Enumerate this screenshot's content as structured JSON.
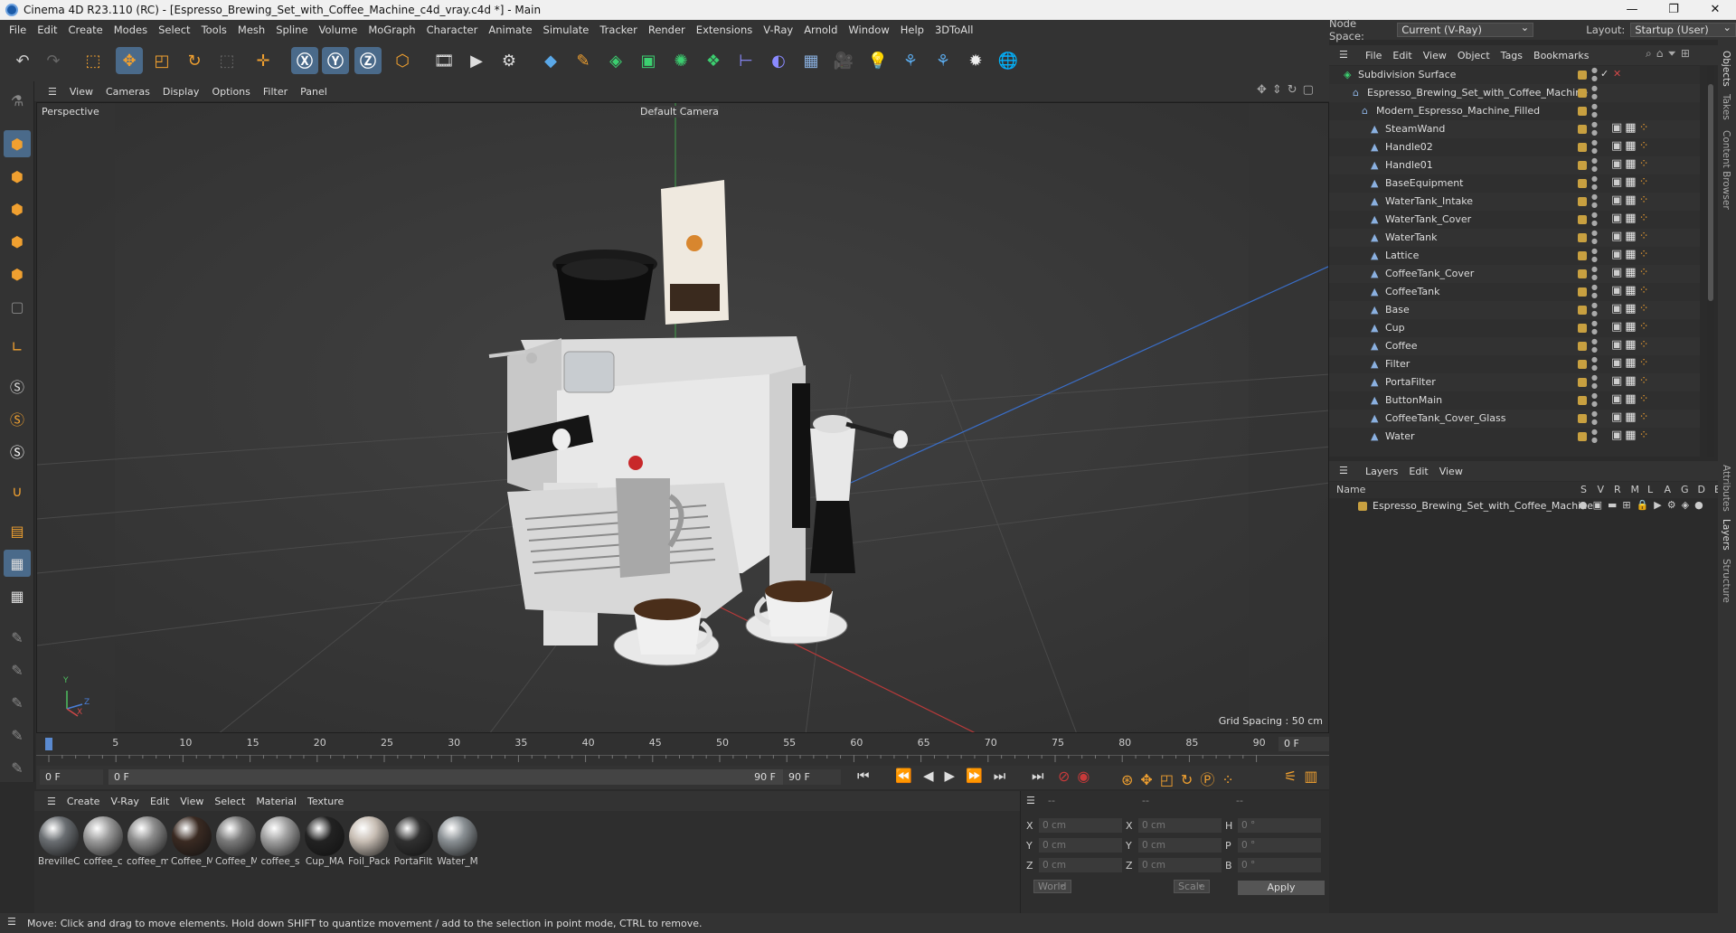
{
  "window": {
    "title": "Cinema 4D R23.110 (RC) - [Espresso_Brewing_Set_with_Coffee_Machine_c4d_vray.c4d *] - Main"
  },
  "menu": [
    "File",
    "Edit",
    "Create",
    "Modes",
    "Select",
    "Tools",
    "Mesh",
    "Spline",
    "Volume",
    "MoGraph",
    "Character",
    "Animate",
    "Simulate",
    "Tracker",
    "Render",
    "Extensions",
    "V-Ray",
    "Arnold",
    "Window",
    "Help",
    "3DToAll"
  ],
  "nodespace": {
    "label": "Node Space:",
    "value": "Current (V-Ray)",
    "layout_label": "Layout:",
    "layout_value": "Startup (User)"
  },
  "viewport": {
    "menu": [
      "View",
      "Cameras",
      "Display",
      "Options",
      "Filter",
      "Panel"
    ],
    "view_name": "Perspective",
    "camera": "Default Camera",
    "grid_spacing": "Grid Spacing : 50 cm",
    "axis_y": "Y",
    "axis_z": "Z",
    "axis_x": "X"
  },
  "timeline": {
    "ticks": [
      "0",
      "5",
      "10",
      "15",
      "20",
      "25",
      "30",
      "35",
      "40",
      "45",
      "50",
      "55",
      "60",
      "65",
      "70",
      "75",
      "80",
      "85",
      "90"
    ],
    "current_frame": "0 F",
    "start_field": "0 F",
    "range_start": "0 F",
    "range_end": "90 F",
    "end_field": "90 F",
    "frame_display": "0 F"
  },
  "materials": {
    "menu": [
      "Create",
      "V-Ray",
      "Edit",
      "View",
      "Select",
      "Material",
      "Texture"
    ],
    "items": [
      {
        "name": "BrevilleC",
        "color": "#6a6e72"
      },
      {
        "name": "coffee_c",
        "color": "#9a9a9a"
      },
      {
        "name": "coffee_m",
        "color": "#8c8c8c"
      },
      {
        "name": "Coffee_M",
        "color": "#3a2a22"
      },
      {
        "name": "Coffee_M",
        "color": "#7a7a7a"
      },
      {
        "name": "coffee_s",
        "color": "#a0a0a0"
      },
      {
        "name": "Cup_MA",
        "color": "#222222"
      },
      {
        "name": "Foil_Pack",
        "color": "#c8beb4"
      },
      {
        "name": "PortaFilt",
        "color": "#303030"
      },
      {
        "name": "Water_M",
        "color": "#8a9094"
      }
    ]
  },
  "coords": {
    "headers": [
      "--",
      "--",
      "--"
    ],
    "rows": [
      {
        "a": "X",
        "av": "0 cm",
        "b": "X",
        "bv": "0 cm",
        "c": "H",
        "cv": "0 °"
      },
      {
        "a": "Y",
        "av": "0 cm",
        "b": "Y",
        "bv": "0 cm",
        "c": "P",
        "cv": "0 °"
      },
      {
        "a": "Z",
        "av": "0 cm",
        "b": "Z",
        "bv": "0 cm",
        "c": "B",
        "cv": "0 °"
      }
    ],
    "world": "World",
    "scale": "Scale",
    "apply": "Apply"
  },
  "objects": {
    "menu": [
      "File",
      "Edit",
      "View",
      "Object",
      "Tags",
      "Bookmarks"
    ],
    "items": [
      {
        "name": "Subdivision Surface",
        "indent": 0,
        "tag": "#c8a040"
      },
      {
        "name": "Espresso_Brewing_Set_with_Coffee_Machine",
        "indent": 1,
        "tag": "#c8a040"
      },
      {
        "name": "Modern_Espresso_Machine_Filled",
        "indent": 2,
        "tag": "#c8a040"
      },
      {
        "name": "SteamWand",
        "indent": 3,
        "tag": "#c8a040"
      },
      {
        "name": "Handle02",
        "indent": 3,
        "tag": "#c8a040"
      },
      {
        "name": "Handle01",
        "indent": 3,
        "tag": "#c8a040"
      },
      {
        "name": "BaseEquipment",
        "indent": 3,
        "tag": "#c8a040"
      },
      {
        "name": "WaterTank_Intake",
        "indent": 3,
        "tag": "#c8a040"
      },
      {
        "name": "WaterTank_Cover",
        "indent": 3,
        "tag": "#c8a040"
      },
      {
        "name": "WaterTank",
        "indent": 3,
        "tag": "#c8a040"
      },
      {
        "name": "Lattice",
        "indent": 3,
        "tag": "#c8a040"
      },
      {
        "name": "CoffeeTank_Cover",
        "indent": 3,
        "tag": "#c8a040"
      },
      {
        "name": "CoffeeTank",
        "indent": 3,
        "tag": "#c8a040"
      },
      {
        "name": "Base",
        "indent": 3,
        "tag": "#c8a040"
      },
      {
        "name": "Cup",
        "indent": 3,
        "tag": "#c8a040"
      },
      {
        "name": "Coffee",
        "indent": 3,
        "tag": "#c8a040"
      },
      {
        "name": "Filter",
        "indent": 3,
        "tag": "#c8a040"
      },
      {
        "name": "PortaFilter",
        "indent": 3,
        "tag": "#c8a040"
      },
      {
        "name": "ButtonMain",
        "indent": 3,
        "tag": "#c8a040"
      },
      {
        "name": "CoffeeTank_Cover_Glass",
        "indent": 3,
        "tag": "#c8a040"
      },
      {
        "name": "Water",
        "indent": 3,
        "tag": "#c8a040"
      }
    ]
  },
  "layers": {
    "menu": [
      "Layers",
      "Edit",
      "View"
    ],
    "header_name": "Name",
    "header_cols": [
      "S",
      "V",
      "R",
      "M",
      "L",
      "A",
      "G",
      "D",
      "E"
    ],
    "items": [
      {
        "name": "Espresso_Brewing_Set_with_Coffee_Machine"
      }
    ]
  },
  "side_tabs": [
    "Objects",
    "Takes",
    "Content Browser",
    "Attributes",
    "Layers",
    "Structure"
  ],
  "status": "Move: Click and drag to move elements. Hold down SHIFT to quantize movement / add to the selection in point mode, CTRL to remove."
}
